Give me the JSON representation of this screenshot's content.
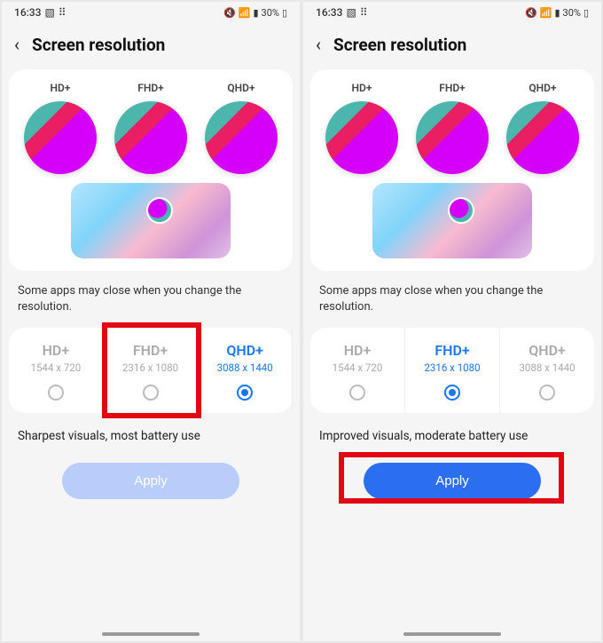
{
  "screens": [
    {
      "status": {
        "time": "16:33",
        "battery": "30%"
      },
      "title": "Screen resolution",
      "previews": [
        "HD+",
        "FHD+",
        "QHD+"
      ],
      "note": "Some apps may close when you change the resolution.",
      "options": [
        {
          "name": "HD+",
          "res": "1544 x 720",
          "selected": false
        },
        {
          "name": "FHD+",
          "res": "2316 x 1080",
          "selected": false
        },
        {
          "name": "QHD+",
          "res": "3088 x 1440",
          "selected": true
        }
      ],
      "highlight_option_index": 1,
      "desc": "Sharpest visuals, most battery use",
      "apply": {
        "label": "Apply",
        "enabled": false,
        "highlighted": false
      }
    },
    {
      "status": {
        "time": "16:33",
        "battery": "30%"
      },
      "title": "Screen resolution",
      "previews": [
        "HD+",
        "FHD+",
        "QHD+"
      ],
      "note": "Some apps may close when you change the resolution.",
      "options": [
        {
          "name": "HD+",
          "res": "1544 x 720",
          "selected": false
        },
        {
          "name": "FHD+",
          "res": "2316 x 1080",
          "selected": true
        },
        {
          "name": "QHD+",
          "res": "3088 x 1440",
          "selected": false
        }
      ],
      "highlight_option_index": null,
      "desc": "Improved visuals, moderate battery use",
      "apply": {
        "label": "Apply",
        "enabled": true,
        "highlighted": true
      }
    }
  ]
}
